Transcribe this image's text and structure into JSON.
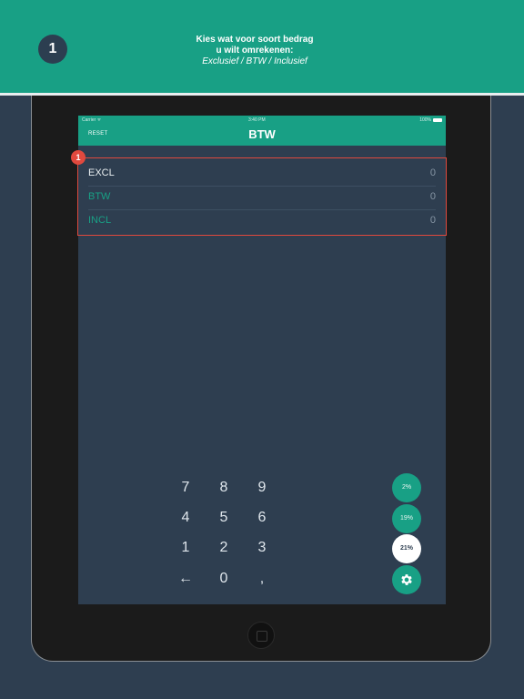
{
  "banner": {
    "step": "1",
    "line1": "Kies wat voor soort bedrag",
    "line2": "u wilt omrekenen:",
    "line3": "Exclusief / BTW / Inclusief"
  },
  "status_bar": {
    "carrier": "Carrier ᯤ",
    "time": "3:40 PM",
    "battery": "100%"
  },
  "app": {
    "reset_label": "RESET",
    "title": "BTW"
  },
  "highlight_badge": "1",
  "rows": [
    {
      "label": "EXCL",
      "value": "0"
    },
    {
      "label": "BTW",
      "value": "0"
    },
    {
      "label": "INCL",
      "value": "0"
    }
  ],
  "keypad": {
    "k7": "7",
    "k8": "8",
    "k9": "9",
    "k4": "4",
    "k5": "5",
    "k6": "6",
    "k1": "1",
    "k2": "2",
    "k3": "3",
    "back": "←",
    "k0": "0",
    "comma": ","
  },
  "rates": [
    {
      "label": "2%",
      "selected": false
    },
    {
      "label": "19%",
      "selected": false
    },
    {
      "label": "21%",
      "selected": true
    }
  ],
  "settings_icon": "gear-icon",
  "colors": {
    "accent": "#18a085",
    "background": "#2e3e50",
    "highlight": "#e0493e"
  }
}
